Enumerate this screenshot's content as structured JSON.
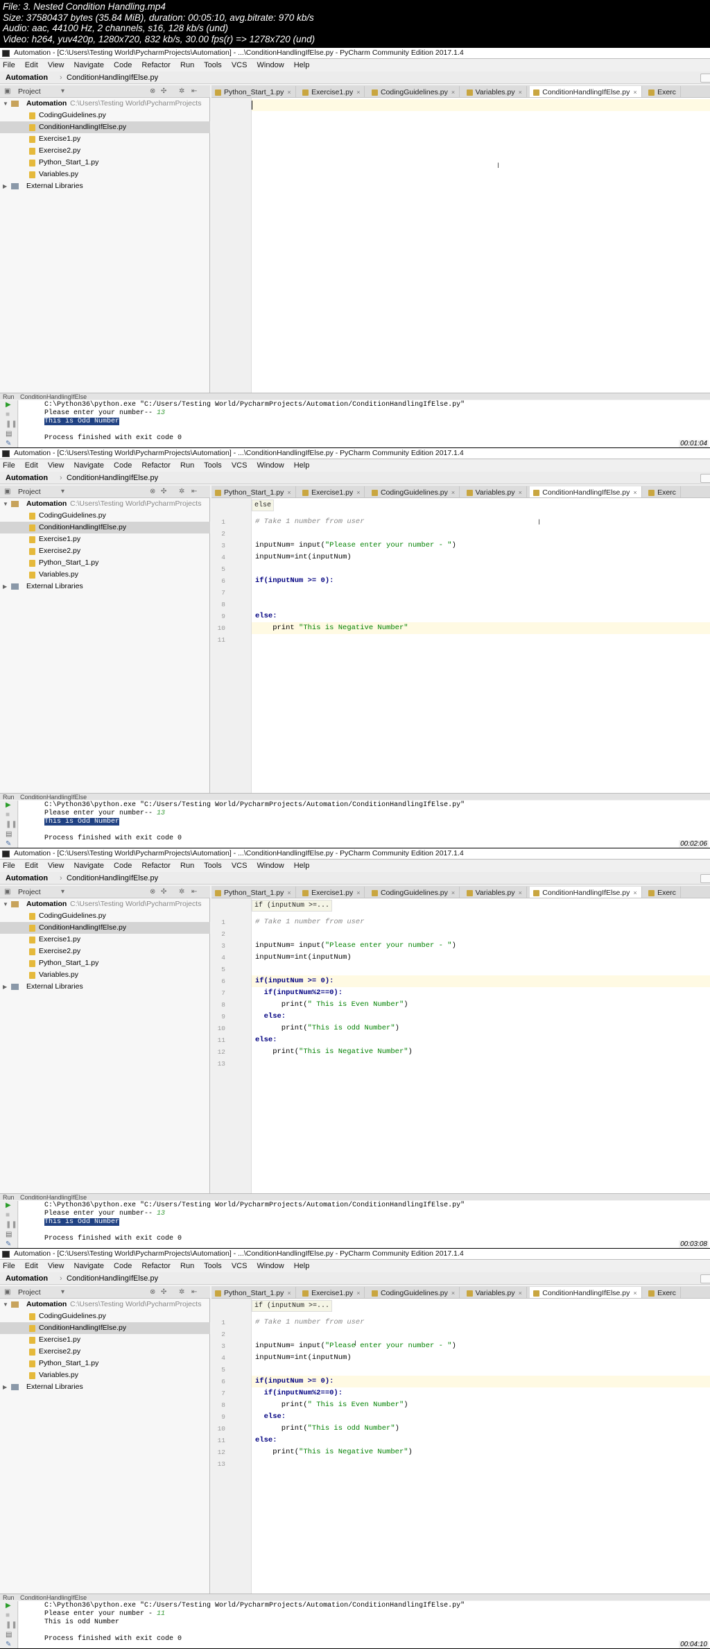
{
  "meta": {
    "lines": [
      "File: 3. Nested Condition Handling.mp4",
      "Size: 37580437 bytes (35.84 MiB), duration: 00:05:10, avg.bitrate: 970 kb/s",
      "Audio: aac, 44100 Hz, 2 channels, s16, 128 kb/s (und)",
      "Video: h264, yuv420p, 1280x720, 832 kb/s, 30.00 fps(r) => 1278x720 (und)"
    ]
  },
  "common": {
    "title": "Automation - [C:\\Users\\Testing World\\PycharmProjects\\Automation] - ...\\ConditionHandlingIfElse.py - PyCharm Community Edition 2017.1.4",
    "menu": [
      "File",
      "Edit",
      "View",
      "Navigate",
      "Code",
      "Refactor",
      "Run",
      "Tools",
      "VCS",
      "Window",
      "Help"
    ],
    "breadcrumb": [
      "Automation",
      "ConditionHandlingIfElse.py"
    ],
    "project_label": "Project",
    "tabs": [
      "Python_Start_1.py",
      "Exercise1.py",
      "CodingGuidelines.py",
      "Variables.py",
      "ConditionHandlingIfElse.py",
      "Exerc"
    ],
    "tree": {
      "root": "Automation",
      "root_path": "C:\\Users\\Testing World\\PycharmProjects",
      "files": [
        "CodingGuidelines.py",
        "ConditionHandlingIfElse.py",
        "Exercise1.py",
        "Exercise2.py",
        "Python_Start_1.py",
        "Variables.py"
      ],
      "external": "External Libraries"
    },
    "run_label": "Run",
    "run_config": "ConditionHandlingIfElse",
    "console_cmd": "C:\\Python36\\python.exe \"C:/Users/Testing World/PycharmProjects/Automation/ConditionHandlingIfElse.py\"",
    "console_exit": "Process finished with exit code 0"
  },
  "frames": [
    {
      "timestamp": "00:01:04",
      "hint": "",
      "code": [],
      "console": {
        "prompt": "Please enter your number-- ",
        "input": "13",
        "output": "This is Odd Number",
        "highlight": true
      }
    },
    {
      "timestamp": "00:02:06",
      "hint": "else",
      "code": [
        "# Take 1 number from user",
        "",
        "inputNum= input(\"Please enter your number - \")",
        "inputNum=int(inputNum)",
        "",
        "if(inputNum >= 0):",
        "",
        "",
        "else:",
        "    print \"This is Negative Number\"",
        ""
      ],
      "console": {
        "prompt": "Please enter your number-- ",
        "input": "13",
        "output": "This is Odd Number",
        "highlight": true
      }
    },
    {
      "timestamp": "00:03:08",
      "hint": "if (inputNum >=...",
      "code": [
        "# Take 1 number from user",
        "",
        "inputNum= input(\"Please enter your number - \")",
        "inputNum=int(inputNum)",
        "",
        "if(inputNum >= 0):",
        "  if(inputNum%2==0):",
        "      print(\" This is Even Number\")",
        "  else:",
        "      print(\"This is odd Number\")",
        "else:",
        "    print(\"This is Negative Number\")",
        ""
      ],
      "console": {
        "prompt": "Please enter your number-- ",
        "input": "13",
        "output": "This is Odd Number",
        "highlight": true
      }
    },
    {
      "timestamp": "00:04:10",
      "hint": "if (inputNum >=...",
      "code": [
        "# Take 1 number from user",
        "",
        "inputNum= input(\"Please enter your number - \")",
        "inputNum=int(inputNum)",
        "",
        "if(inputNum >= 0):",
        "  if(inputNum%2==0):",
        "      print(\" This is Even Number\")",
        "  else:",
        "      print(\"This is odd Number\")",
        "else:",
        "    print(\"This is Negative Number\")",
        ""
      ],
      "console": {
        "prompt": "Please enter your number - ",
        "input": "11",
        "output": "This is odd Number",
        "highlight": false
      }
    }
  ]
}
